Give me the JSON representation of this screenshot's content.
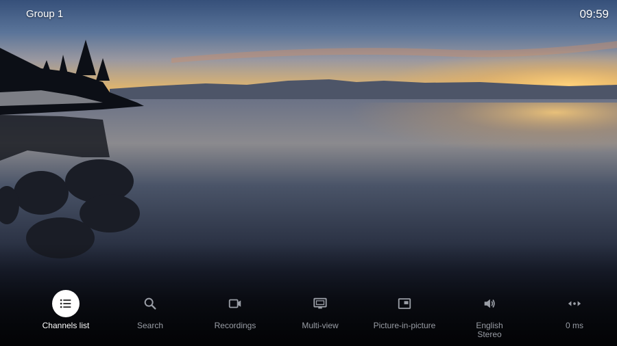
{
  "header": {
    "group_title": "Group 1",
    "clock": "09:59"
  },
  "colors": {
    "active_icon_bg": "#ffffff",
    "active_label": "#ffffff",
    "inactive": "#9a9ea6"
  },
  "toolbar": {
    "items": [
      {
        "label": "Channels list",
        "icon": "list-icon",
        "active": true
      },
      {
        "label": "Search",
        "icon": "search-icon",
        "active": false
      },
      {
        "label": "Recordings",
        "icon": "video-camera-icon",
        "active": false
      },
      {
        "label": "Multi-view",
        "icon": "monitor-icon",
        "active": false
      },
      {
        "label": "Picture-in-picture",
        "icon": "picture-in-picture-icon",
        "active": false
      },
      {
        "label": "English\nStereo",
        "icon": "speaker-icon",
        "active": false
      },
      {
        "label": "0 ms",
        "icon": "audio-delay-icon",
        "active": false
      }
    ]
  }
}
